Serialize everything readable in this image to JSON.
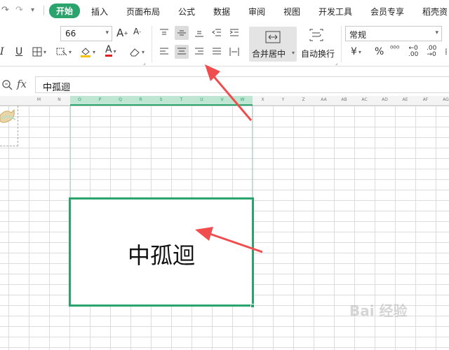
{
  "tabs": [
    "开始",
    "插入",
    "页面布局",
    "公式",
    "数据",
    "审阅",
    "视图",
    "开发工具",
    "会员专享",
    "稻壳资"
  ],
  "active_tab": "开始",
  "ribbon": {
    "font_size": "66",
    "merge_label": "合并居中",
    "wrap_label": "自动换行",
    "number_format": "常规",
    "currency_symbol": "¥",
    "percent_symbol": "%",
    "thousands_symbol": "⁰⁰⁰"
  },
  "formula_bar": {
    "fx_label": "fx",
    "cell_content": "中孤迴"
  },
  "columns": [
    "M",
    "N",
    "O",
    "P",
    "Q",
    "R",
    "S",
    "T",
    "U",
    "V",
    "W",
    "X",
    "Y",
    "Z",
    "AA",
    "AB",
    "AC",
    "AD",
    "AE",
    "AF",
    "AG"
  ],
  "selected_columns": [
    "O",
    "P",
    "Q",
    "R",
    "S",
    "T",
    "U",
    "V",
    "W"
  ],
  "merged_cell_text": "中孤迴",
  "watermark": "Bai 经验",
  "colors": {
    "accent": "#2aa46c",
    "arrow": "#f04e4e"
  }
}
